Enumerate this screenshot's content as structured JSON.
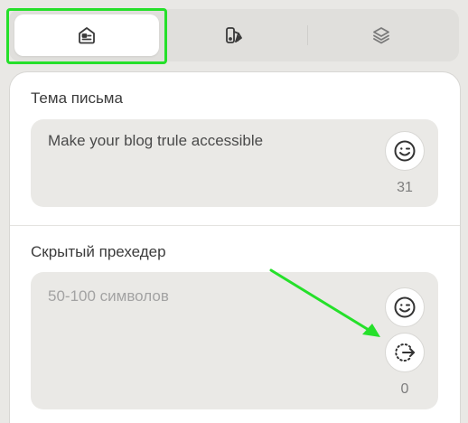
{
  "tabs": [
    {
      "icon": "envelope-card-icon",
      "active": true
    },
    {
      "icon": "palette-fill-icon",
      "active": false
    },
    {
      "icon": "layers-icon",
      "active": false
    }
  ],
  "subject": {
    "label": "Тема письма",
    "value": "Make your blog trule accessible",
    "counter": "31",
    "emoji_icon": "smiley-wink-icon"
  },
  "preheader": {
    "label": "Скрытый прехедер",
    "placeholder": "50-100 символов",
    "counter": "0",
    "emoji_icon": "smiley-wink-icon",
    "action_icon": "dotted-circle-arrow-icon"
  },
  "colors": {
    "highlight": "#25e02a",
    "annotation_arrow": "#25e02a"
  }
}
